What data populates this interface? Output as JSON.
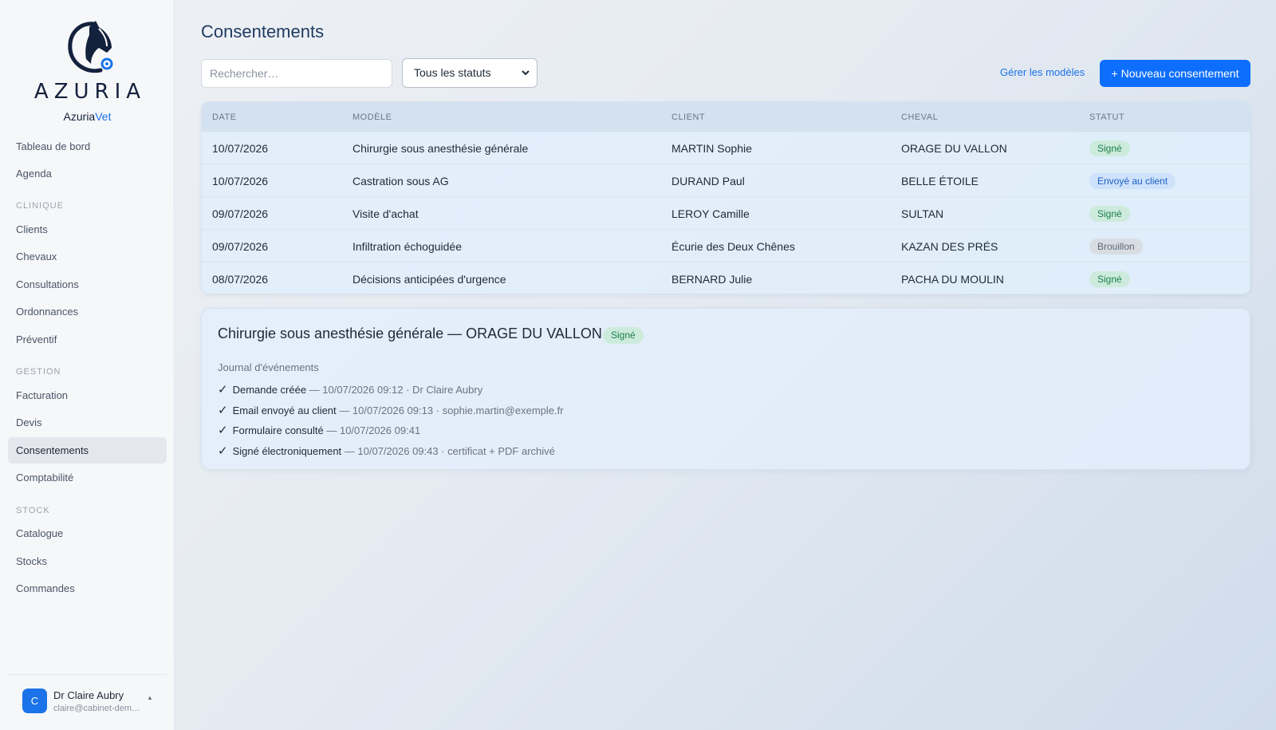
{
  "app": {
    "logo_text": "AZURIA",
    "name_part1": "Azuria",
    "name_part2": "Vet",
    "brand_color": "#1a73e8"
  },
  "sidebar": {
    "top_items": [
      {
        "label": "Tableau de bord"
      },
      {
        "label": "Agenda"
      }
    ],
    "sections": [
      {
        "title": "Clinique",
        "items": [
          "Clients",
          "Chevaux",
          "Consultations",
          "Ordonnances",
          "Préventif"
        ]
      },
      {
        "title": "Gestion",
        "items": [
          "Facturation",
          "Devis",
          "Consentements",
          "Comptabilité"
        ]
      },
      {
        "title": "Stock",
        "items": [
          "Catalogue",
          "Stocks",
          "Commandes"
        ]
      }
    ],
    "active_item": "Consentements",
    "user": {
      "initial": "C",
      "name": "Dr Claire Aubry",
      "email": "claire@cabinet-dem…",
      "caret": "▲"
    }
  },
  "page": {
    "title": "Consentements",
    "search_placeholder": "Rechercher…",
    "status_filter": "Tous les statuts",
    "manage_templates": "Gérer les modèles",
    "new_button": "+ Nouveau consentement"
  },
  "table": {
    "headers": [
      "Date",
      "Modèle",
      "Client",
      "Cheval",
      "Statut"
    ],
    "rows": [
      {
        "date": "10/07/2026",
        "model": "Chirurgie sous anesthésie générale",
        "client": "MARTIN Sophie",
        "horse": "ORAGE DU VALLON",
        "status": "Signé",
        "status_type": "signe"
      },
      {
        "date": "10/07/2026",
        "model": "Castration sous AG",
        "client": "DURAND Paul",
        "horse": "BELLE ÉTOILE",
        "status": "Envoyé au client",
        "status_type": "envoye"
      },
      {
        "date": "09/07/2026",
        "model": "Visite d'achat",
        "client": "LEROY Camille",
        "horse": "SULTAN",
        "status": "Signé",
        "status_type": "signe"
      },
      {
        "date": "09/07/2026",
        "model": "Infiltration échoguidée",
        "client": "Écurie des Deux Chênes",
        "horse": "KAZAN DES PRÉS",
        "status": "Brouillon",
        "status_type": "brouillon"
      },
      {
        "date": "08/07/2026",
        "model": "Décisions anticipées d'urgence",
        "client": "BERNARD Julie",
        "horse": "PACHA DU MOULIN",
        "status": "Signé",
        "status_type": "signe"
      }
    ]
  },
  "detail": {
    "title": "Chirurgie sous anesthésie générale — ORAGE DU VALLON",
    "status": "Signé",
    "journal_label": "Journal d'événements",
    "events": [
      {
        "icon": "✓",
        "label": "Demande créée",
        "meta": " — 10/07/2026 09:12 · Dr Claire Aubry"
      },
      {
        "icon": "✓",
        "label": "Email envoyé au client",
        "meta": " — 10/07/2026 09:13 · sophie.martin@exemple.fr"
      },
      {
        "icon": "✓",
        "label": "Formulaire consulté",
        "meta": " — 10/07/2026 09:41"
      },
      {
        "icon": "✓",
        "label": "Signé électroniquement",
        "meta": " — 10/07/2026 09:43 · certificat + PDF archivé"
      }
    ]
  }
}
